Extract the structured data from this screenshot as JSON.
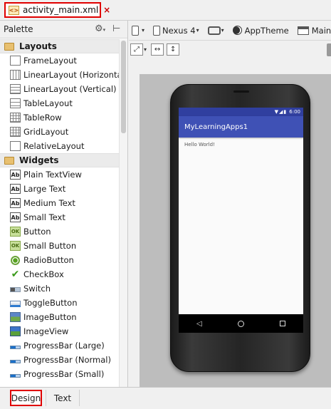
{
  "file_tab": {
    "filename": "activity_main.xml",
    "icon": "xml-file-icon",
    "close_glyph": "×"
  },
  "palette": {
    "title": "Palette",
    "groups": [
      {
        "label": "Layouts",
        "items": [
          "FrameLayout",
          "LinearLayout (Horizontal)",
          "LinearLayout (Vertical)",
          "TableLayout",
          "TableRow",
          "GridLayout",
          "RelativeLayout"
        ]
      },
      {
        "label": "Widgets",
        "items": [
          "Plain TextView",
          "Large Text",
          "Medium Text",
          "Small Text",
          "Button",
          "Small Button",
          "RadioButton",
          "CheckBox",
          "Switch",
          "ToggleButton",
          "ImageButton",
          "ImageView",
          "ProgressBar (Large)",
          "ProgressBar (Normal)",
          "ProgressBar (Small)"
        ]
      }
    ]
  },
  "toolbar": {
    "device": "Nexus 4",
    "theme": "AppTheme",
    "activity": "MainA"
  },
  "icons": {
    "ab_glyph": "Ab",
    "ok_glyph": "OK"
  },
  "preview": {
    "status_time": "6:00",
    "app_title": "MyLearningApps1",
    "content_text": "Hello World!",
    "status_color": "#303f9f",
    "appbar_color": "#3f51b5"
  },
  "bottom_tabs": {
    "design": "Design",
    "text": "Text"
  }
}
